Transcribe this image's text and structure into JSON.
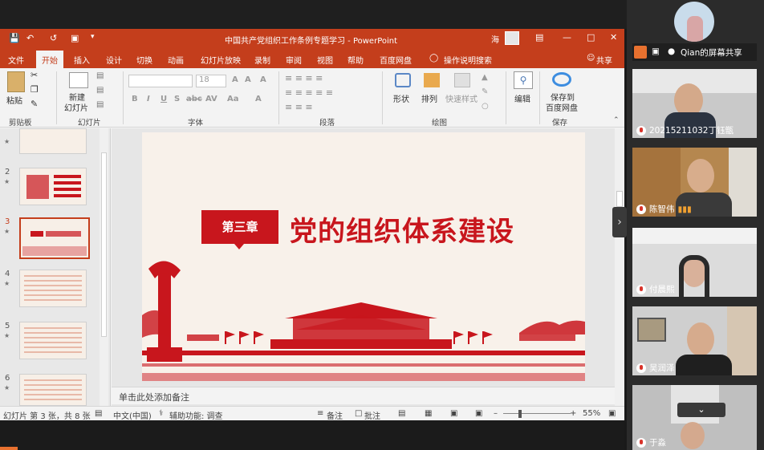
{
  "window": {
    "title": "中国共产党组织工作条例专题学习 - PowerPoint",
    "user": "海"
  },
  "tabs": [
    "文件",
    "开始",
    "插入",
    "设计",
    "切换",
    "动画",
    "幻灯片放映",
    "录制",
    "审阅",
    "视图",
    "帮助",
    "百度网盘",
    "操作说明搜索"
  ],
  "active_tab": "开始",
  "share_label": "共享",
  "ribbon": {
    "paste": "粘贴",
    "new_slide_line1": "新建",
    "new_slide_line2": "幻灯片",
    "font_size": "18",
    "shape": "形状",
    "arrange": "排列",
    "quick_style": "快速样式",
    "edit": "编辑",
    "save_to_line1": "保存到",
    "save_to_line2": "百度网盘",
    "groups": [
      "剪贴板",
      "幻灯片",
      "字体",
      "段落",
      "绘图",
      "保存"
    ]
  },
  "thumbnails": [
    {
      "num": "2"
    },
    {
      "num": "3"
    },
    {
      "num": "4"
    },
    {
      "num": "5"
    },
    {
      "num": "6"
    }
  ],
  "slide": {
    "chapter": "第三章",
    "title": "党的组织体系建设"
  },
  "notes_placeholder": "单击此处添加备注",
  "status": {
    "slide_info": "幻灯片 第 3 张，共 8 张",
    "language": "中文(中国)",
    "accessibility": "辅助功能: 调查",
    "notes": "备注",
    "comments": "批注",
    "zoom": "55%"
  },
  "meeting": {
    "sharer": "Qian的屏幕共享",
    "participants": [
      {
        "name": "20215211032丁钰甑"
      },
      {
        "name": "陈智伟"
      },
      {
        "name": "付晨熙"
      },
      {
        "name": "吴润泽"
      },
      {
        "name": "于淼"
      }
    ]
  },
  "colors": {
    "ppt_accent": "#c43e1c",
    "slide_red": "#c8161d",
    "slide_bg": "#f8f1ea"
  }
}
